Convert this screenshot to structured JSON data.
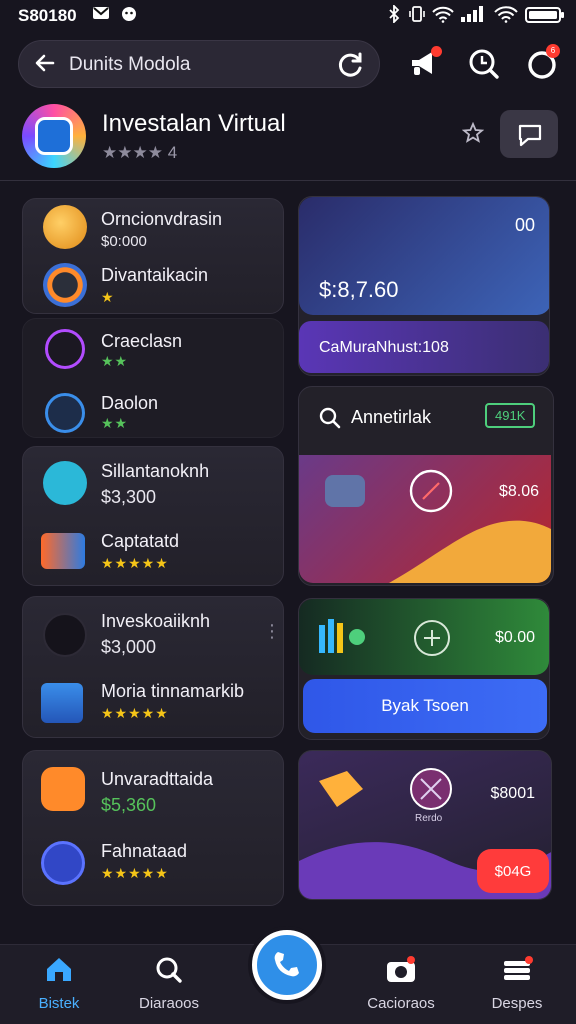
{
  "status_bar": {
    "time": "S80180",
    "icons": [
      "bluetooth-icon",
      "vibrate-icon",
      "wifi-icon",
      "signal-icon",
      "battery-icon"
    ]
  },
  "header": {
    "search_text": "Dunits Modola",
    "icons": [
      "back-arrow-icon",
      "refresh-icon",
      "announcement-icon",
      "zoom-icon",
      "notification-icon"
    ]
  },
  "app": {
    "title": "Investalan Virtual",
    "rating_text": "4",
    "rating_stars": "★★★★"
  },
  "left_cards": {
    "card1": [
      {
        "name": "Orncionvdrasin",
        "value": "$0:000",
        "stars": ""
      },
      {
        "name": "Divantaikacin",
        "value": "",
        "stars": "★"
      }
    ],
    "card2": [
      {
        "name": "Craeclasn",
        "value": "",
        "stars": "★★"
      },
      {
        "name": "Daolon",
        "value": "",
        "stars": "★★"
      }
    ],
    "card3": [
      {
        "name": "Sillantanoknh",
        "value": "$3,300",
        "stars": ""
      },
      {
        "name": "Captatatd",
        "value": "",
        "stars": "★★★★★"
      }
    ],
    "card4": [
      {
        "name": "Inveskoaiiknh",
        "value": "$3,000",
        "stars": ""
      },
      {
        "name": "Moria tinnamarkib",
        "value": "",
        "stars": "★★★★★"
      }
    ],
    "card5": [
      {
        "name": "Unvaradttaida",
        "value": "$5,360",
        "stars": ""
      },
      {
        "name": "Fahnataad",
        "value": "",
        "stars": "★★★★★"
      }
    ]
  },
  "right_cards": {
    "balance": {
      "corner": "00",
      "amount": "$:8,7.60",
      "label": "CaMuraNhust:108"
    },
    "analytics": {
      "title": "Annetirlak",
      "badge": "491K",
      "price": "$8.06"
    },
    "growth": {
      "price": "$0.00",
      "button": "Byak Tsoen"
    },
    "promo": {
      "price": "$8001",
      "caption": "Rerdo",
      "button": "$04G"
    }
  },
  "nav": {
    "items": [
      {
        "label": "Bistek"
      },
      {
        "label": "Diaraoos"
      },
      {
        "label": "Cacioraos"
      },
      {
        "label": "Despes"
      }
    ]
  },
  "colors": {
    "accent": "#2f8fe8",
    "background": "#17151f",
    "star": "#f5c518",
    "green": "#56c25b"
  }
}
